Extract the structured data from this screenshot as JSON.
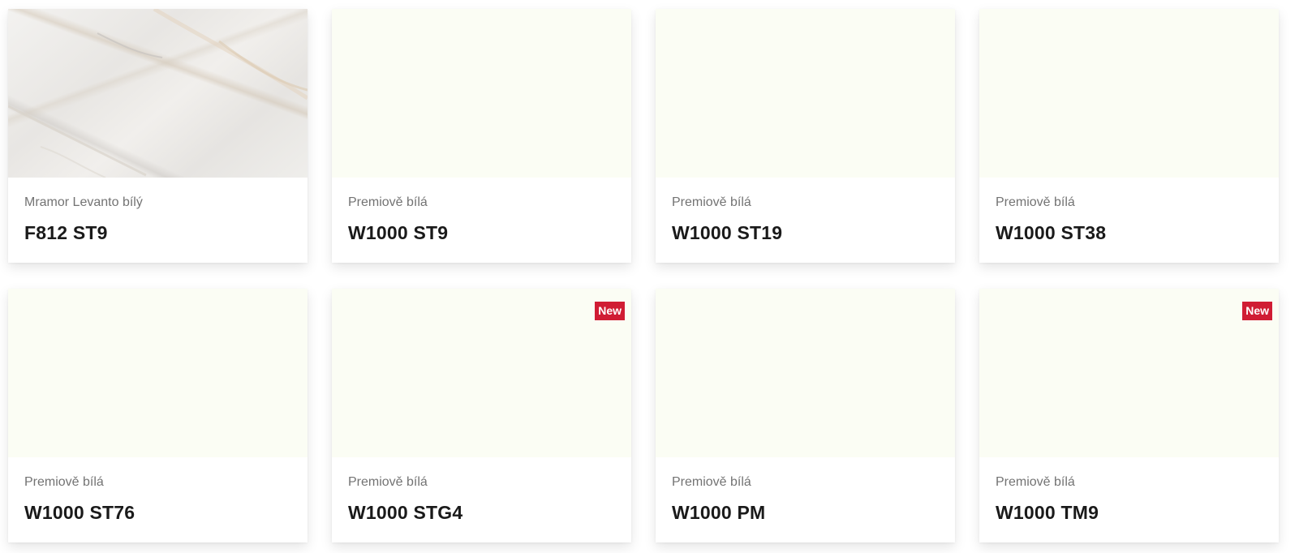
{
  "colors": {
    "swatch_cream": "#fbfdf4",
    "badge_red": "#d01c34",
    "subtitle_gray": "#737373",
    "code_black": "#1a1a1a"
  },
  "cards": [
    {
      "subtitle": "Mramor Levanto bílý",
      "code": "F812 ST9",
      "swatch": "marble",
      "badge": ""
    },
    {
      "subtitle": "Premiově bílá",
      "code": "W1000 ST9",
      "swatch": "cream",
      "badge": ""
    },
    {
      "subtitle": "Premiově bílá",
      "code": "W1000 ST19",
      "swatch": "cream",
      "badge": ""
    },
    {
      "subtitle": "Premiově bílá",
      "code": "W1000 ST38",
      "swatch": "cream",
      "badge": ""
    },
    {
      "subtitle": "Premiově bílá",
      "code": "W1000 ST76",
      "swatch": "cream",
      "badge": ""
    },
    {
      "subtitle": "Premiově bílá",
      "code": "W1000 STG4",
      "swatch": "cream",
      "badge": "New"
    },
    {
      "subtitle": "Premiově bílá",
      "code": "W1000 PM",
      "swatch": "cream",
      "badge": ""
    },
    {
      "subtitle": "Premiově bílá",
      "code": "W1000 TM9",
      "swatch": "cream",
      "badge": "New"
    }
  ]
}
